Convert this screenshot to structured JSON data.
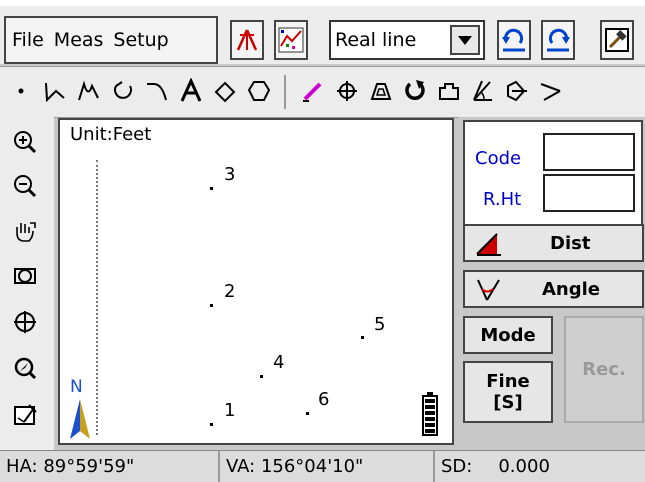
{
  "menu": {
    "file": "File",
    "meas": "Meas",
    "setup": "Setup"
  },
  "toolbar": {
    "line_type": "Real line"
  },
  "canvas": {
    "unit_label": "Unit:Feet",
    "north_label": "N",
    "points": [
      "3",
      "2",
      "5",
      "4",
      "6",
      "1"
    ]
  },
  "panel": {
    "code_label": "Code",
    "code_value": "",
    "rht_label": "R.Ht",
    "rht_value": "",
    "dist_label": "Dist",
    "angle_label": "Angle",
    "mode_label": "Mode",
    "rec_label": "Rec.",
    "fine_label": "Fine",
    "fine_sub": "[S]"
  },
  "status": {
    "ha": "HA:  89°59'59\"",
    "va": "VA: 156°04'10\"",
    "sd_label": "SD:",
    "sd_value": "0.000"
  },
  "colors": {
    "accent_red": "#cc0000",
    "label_blue": "#0000cc",
    "north_blue": "#1a4fd0"
  },
  "icons": [
    "point-icon",
    "polyline-icon",
    "curve-icon",
    "arc-icon",
    "spiral-icon",
    "text-icon",
    "diamond-icon",
    "circle-icon",
    "erase-icon",
    "move-icon",
    "area-icon",
    "rotate-icon",
    "offset-icon",
    "angle-icon",
    "intersect-icon",
    "extend-icon",
    "zoom-in-icon",
    "zoom-out-icon",
    "pan-icon",
    "zoom-extents-icon",
    "zoom-window-icon",
    "zoom-center-icon",
    "layer-icon",
    "undo-icon",
    "redo-icon",
    "exit-icon",
    "station-icon",
    "graph-icon",
    "battery-icon",
    "north-arrow-icon"
  ]
}
